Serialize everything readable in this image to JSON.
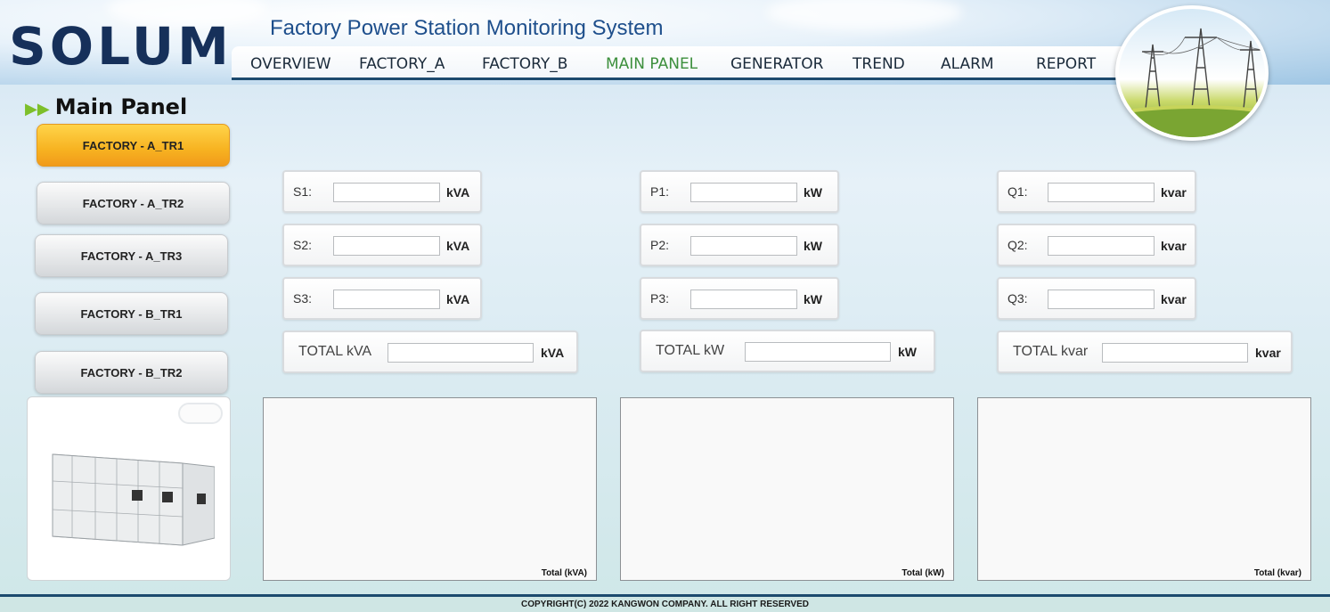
{
  "header": {
    "logo": "SOLUM",
    "app_title": "Factory Power Station Monitoring System"
  },
  "nav": {
    "items": [
      "OVERVIEW",
      "FACTORY_A",
      "FACTORY_B",
      "MAIN PANEL",
      "GENERATOR",
      "TREND",
      "ALARM",
      "REPORT"
    ],
    "active": "MAIN PANEL"
  },
  "page": {
    "title": "Main Panel"
  },
  "sidebar": {
    "buttons": [
      "FACTORY - A_TR1",
      "FACTORY - A_TR2",
      "FACTORY - A_TR3",
      "FACTORY - B_TR1",
      "FACTORY - B_TR2"
    ],
    "active": "FACTORY - A_TR1"
  },
  "fields": {
    "apparent": [
      {
        "label": "S1:",
        "value": "",
        "unit": "kVA"
      },
      {
        "label": "S2:",
        "value": "",
        "unit": "kVA"
      },
      {
        "label": "S3:",
        "value": "",
        "unit": "kVA"
      }
    ],
    "active_power": [
      {
        "label": "P1:",
        "value": "",
        "unit": "kW"
      },
      {
        "label": "P2:",
        "value": "",
        "unit": "kW"
      },
      {
        "label": "P3:",
        "value": "",
        "unit": "kW"
      }
    ],
    "reactive": [
      {
        "label": "Q1:",
        "value": "",
        "unit": "kvar"
      },
      {
        "label": "Q2:",
        "value": "",
        "unit": "kvar"
      },
      {
        "label": "Q3:",
        "value": "",
        "unit": "kvar"
      }
    ],
    "totals": [
      {
        "label": "TOTAL kVA",
        "value": "",
        "unit": "kVA"
      },
      {
        "label": "TOTAL kW",
        "value": "",
        "unit": "kW"
      },
      {
        "label": "TOTAL kvar",
        "value": "",
        "unit": "kvar"
      }
    ]
  },
  "charts": [
    {
      "title": "Total (kVA)"
    },
    {
      "title": "Total (kW)"
    },
    {
      "title": "Total (kvar)"
    }
  ],
  "footer": {
    "copyright": "COPYRIGHT(C) 2022 KANGWON COMPANY. ALL RIGHT RESERVED"
  },
  "colors": {
    "brand": "#16305a",
    "active_nav": "#3c8f3c",
    "active_button": "#f7b321",
    "nav_border": "#1c4a6e"
  }
}
